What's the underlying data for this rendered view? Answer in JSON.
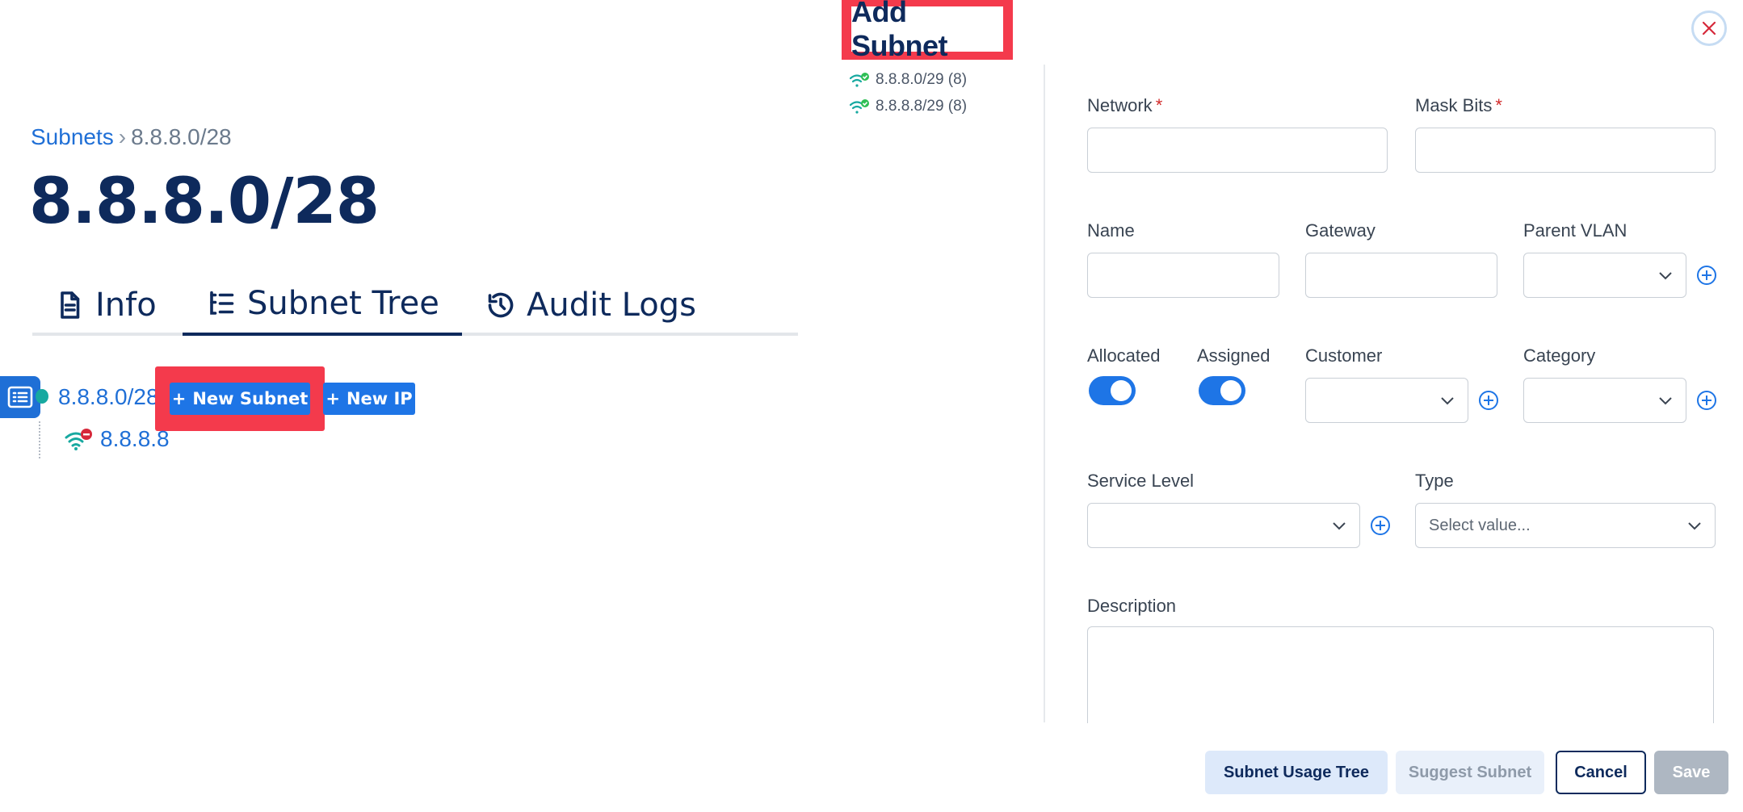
{
  "breadcrumb": {
    "parent": "Subnets",
    "separator": "›",
    "current": "8.8.8.0/28"
  },
  "page_title": "8.8.8.0/28",
  "tabs": [
    {
      "label": "Info",
      "icon": "document-icon"
    },
    {
      "label": "Subnet Tree",
      "icon": "tree-list-icon",
      "active": true
    },
    {
      "label": "Audit Logs",
      "icon": "history-icon"
    }
  ],
  "tree": {
    "root": "8.8.8.0/28",
    "new_subnet_label": "New Subnet",
    "new_ip_label": "New IP",
    "child": "8.8.8.8"
  },
  "modal": {
    "title": "Add Subnet",
    "suggestions": [
      "8.8.8.0/29 (8)",
      "8.8.8.8/29 (8)"
    ],
    "fields": {
      "network": {
        "label": "Network",
        "required": "*",
        "value": ""
      },
      "mask_bits": {
        "label": "Mask Bits",
        "required": "*",
        "value": ""
      },
      "name": {
        "label": "Name",
        "value": ""
      },
      "gateway": {
        "label": "Gateway",
        "value": ""
      },
      "parent_vlan": {
        "label": "Parent VLAN",
        "value": ""
      },
      "allocated": {
        "label": "Allocated",
        "on": true
      },
      "assigned": {
        "label": "Assigned",
        "on": true
      },
      "customer": {
        "label": "Customer",
        "value": ""
      },
      "category": {
        "label": "Category",
        "value": ""
      },
      "service_level": {
        "label": "Service Level",
        "value": ""
      },
      "type": {
        "label": "Type",
        "placeholder": "Select value..."
      },
      "description": {
        "label": "Description",
        "value": ""
      }
    },
    "buttons": {
      "usage_tree": "Subnet Usage Tree",
      "suggest": "Suggest Subnet",
      "cancel": "Cancel",
      "save": "Save"
    }
  },
  "colors": {
    "primary": "#1e75e6",
    "navy": "#0e2a5c",
    "highlight": "#f43a4c",
    "required": "#d12a2a"
  }
}
